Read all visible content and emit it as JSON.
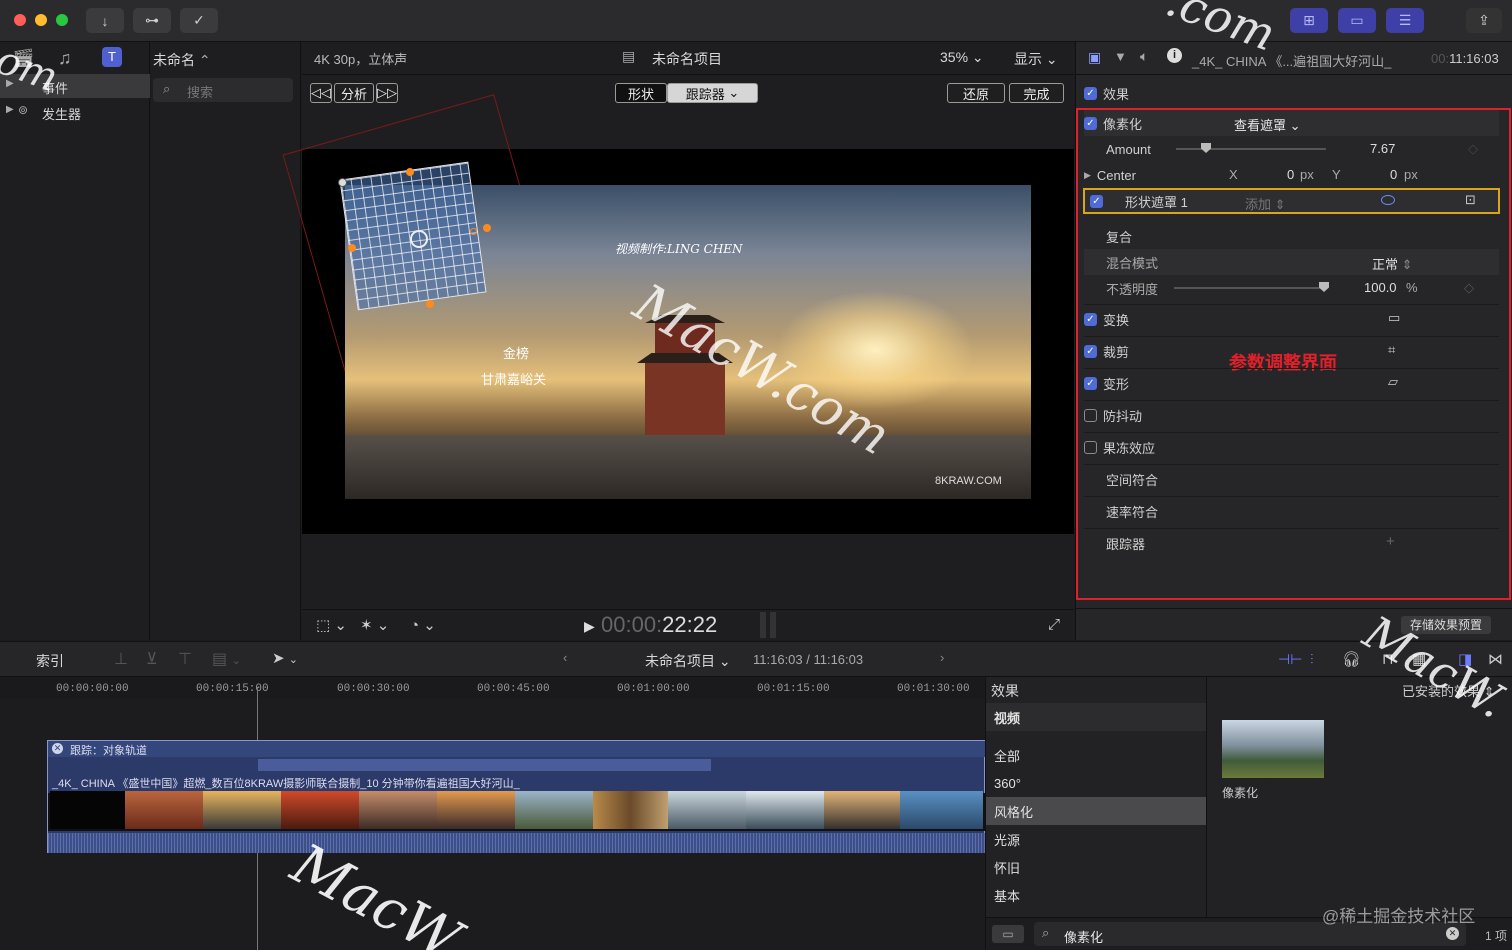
{
  "titlebar": {
    "icons": [
      "import-icon",
      "key-icon",
      "checkmark-icon"
    ],
    "right_icons": [
      "grid-view-icon",
      "timeline-view-icon",
      "inspector-toggle-icon",
      "share-icon"
    ]
  },
  "library": {
    "items": [
      {
        "label": "事件"
      },
      {
        "label": "发生器"
      }
    ]
  },
  "browser": {
    "title": "未命名",
    "search_placeholder": "搜索"
  },
  "viewer": {
    "format": "4K 30p，立体声",
    "project": "未命名项目",
    "zoom": "35%",
    "display": "显示",
    "analyze": "分析",
    "tab_shape": "形状",
    "tab_tracker": "跟踪器",
    "restore": "还原",
    "done": "完成",
    "timecode_dim": "00:00:",
    "timecode": "22:22",
    "frame_texts": {
      "credit": "视频制作:LING CHEN",
      "cal1": "金榜",
      "cal2": "甘肃嘉峪关",
      "brand": "8KRAW.COM"
    }
  },
  "inspector": {
    "clip_name": "_4K_ CHINA 《...遍祖国大好河山_",
    "timecode_dim": "00:",
    "timecode": "11:16:03",
    "effects": "效果",
    "pixelate": "像素化",
    "view_mask": "查看遮罩",
    "amount_label": "Amount",
    "amount_value": "7.67",
    "amount_fraction": 0.2,
    "center_label": "Center",
    "x_label": "X",
    "x_value": "0",
    "y_label": "Y",
    "y_value": "0",
    "px": "px",
    "shape_mask": "形状遮罩 1",
    "add": "添加",
    "composite": "复合",
    "blend_mode": "混合模式",
    "blend_value": "正常",
    "opacity": "不透明度",
    "opacity_value": "100.0",
    "percent": "%",
    "opacity_fraction": 1.0,
    "transform": "变换",
    "crop": "裁剪",
    "distort": "变形",
    "stabilize": "防抖动",
    "rolling_shutter": "果冻效应",
    "spatial_conform": "空间符合",
    "rate_conform": "速率符合",
    "tracker": "跟踪器",
    "annotation": "参数调整界面",
    "save_preset": "存储效果预置"
  },
  "timeline_bar": {
    "index": "索引",
    "project": "未命名项目",
    "duration": "11:16:03 / 11:16:03"
  },
  "timeline": {
    "ticks": [
      "00:00:00:00",
      "00:00:15:00",
      "00:00:30:00",
      "00:00:45:00",
      "00:01:00:00",
      "00:01:15:00",
      "00:01:30:00"
    ],
    "tracker_label": "跟踪：对象轨道",
    "clip_title": "_4K_ CHINA 《盛世中国》超燃_数百位8KRAW摄影师联合摄制_10 分钟带你看遍祖国大好河山_"
  },
  "effects_browser": {
    "title": "效果",
    "installed": "已安装的效果",
    "categories": [
      "视频",
      "全部",
      "360°",
      "风格化",
      "光源",
      "怀旧",
      "基本"
    ],
    "selected": "风格化",
    "result_label": "像素化",
    "search_value": "像素化",
    "count": "1 项"
  },
  "watermarks": {
    "macw": "MacW.com",
    "juejin": "@稀土掘金技术社区"
  },
  "colors": {
    "accent": "#4f6bd8",
    "annotation_red": "#e0202a",
    "mask_yellow": "#d9a520"
  }
}
